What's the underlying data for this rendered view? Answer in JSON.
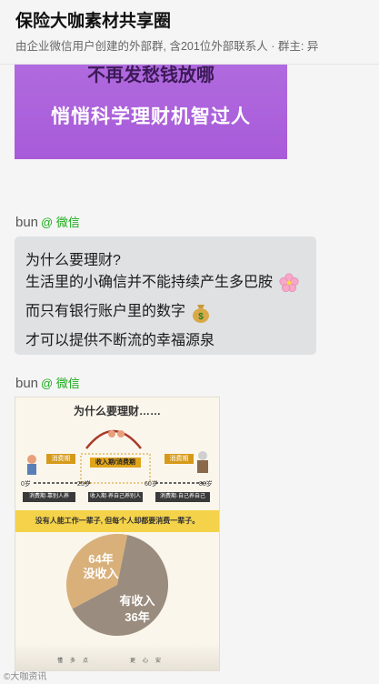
{
  "header": {
    "title": "保险大咖素材共享圈",
    "subtitle": "由企业微信用户创建的外部群, 含201位外部联系人 · 群主: 异"
  },
  "image1": {
    "top_text": "不再发愁钱放哪",
    "main_text": "悄悄科学理财机智过人"
  },
  "messages": [
    {
      "sender": "bun",
      "tag": "@ 微信"
    },
    {
      "sender": "bun",
      "tag": "@ 微信"
    }
  ],
  "bubble": {
    "line1": "为什么要理财?",
    "line2": "生活里的小确信并不能持续产生多巴胺",
    "line3": "而只有银行账户里的数字",
    "line4": "才可以提供不断流的幸福源泉"
  },
  "poster": {
    "title": "为什么要理财……",
    "periods": [
      "消费期",
      "收入期/消费期",
      "消费期"
    ],
    "ages": [
      "0岁",
      "25岁",
      "60岁",
      "88岁"
    ],
    "stages": [
      "消费期·靠别人养",
      "收入期·养自己养别人",
      "消费期·自己养自己"
    ],
    "banner": "没有人能工作一辈子, 但每个人却都要消费一辈子。",
    "pie_no_income": "64年\n没收入",
    "pie_income": "有收入\n36年",
    "bottom_words": [
      "懂",
      "多",
      "点",
      "更",
      "心",
      "安"
    ],
    "chart_data": {
      "type": "pie",
      "labels": [
        "没收入",
        "有收入"
      ],
      "values": [
        64,
        36
      ],
      "unit": "年"
    }
  },
  "watermark": "©大咖资讯"
}
